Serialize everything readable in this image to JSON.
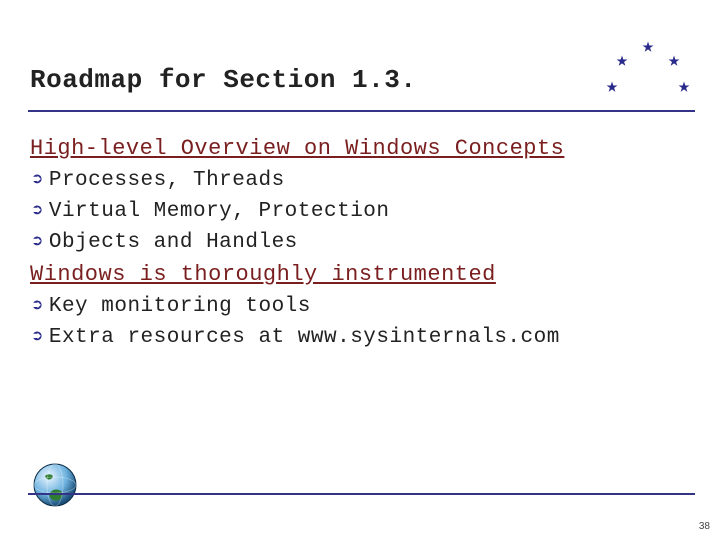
{
  "title": "Roadmap for Section 1.3.",
  "sections": [
    {
      "heading": "High-level Overview on Windows Concepts",
      "bullets": [
        "Processes, Threads",
        "Virtual Memory, Protection",
        "Objects and Handles"
      ]
    },
    {
      "heading": "Windows is thoroughly instrumented",
      "bullets": [
        "Key monitoring tools",
        "Extra resources at  www.sysinternals.com"
      ]
    }
  ],
  "page_number": "38",
  "colors": {
    "accent_blue": "#2a2a8a",
    "heading_red": "#7a1f1f",
    "rule_blue": "#333388"
  },
  "icons": {
    "bullet": "➲",
    "star": "★",
    "globe": "globe-icon"
  }
}
